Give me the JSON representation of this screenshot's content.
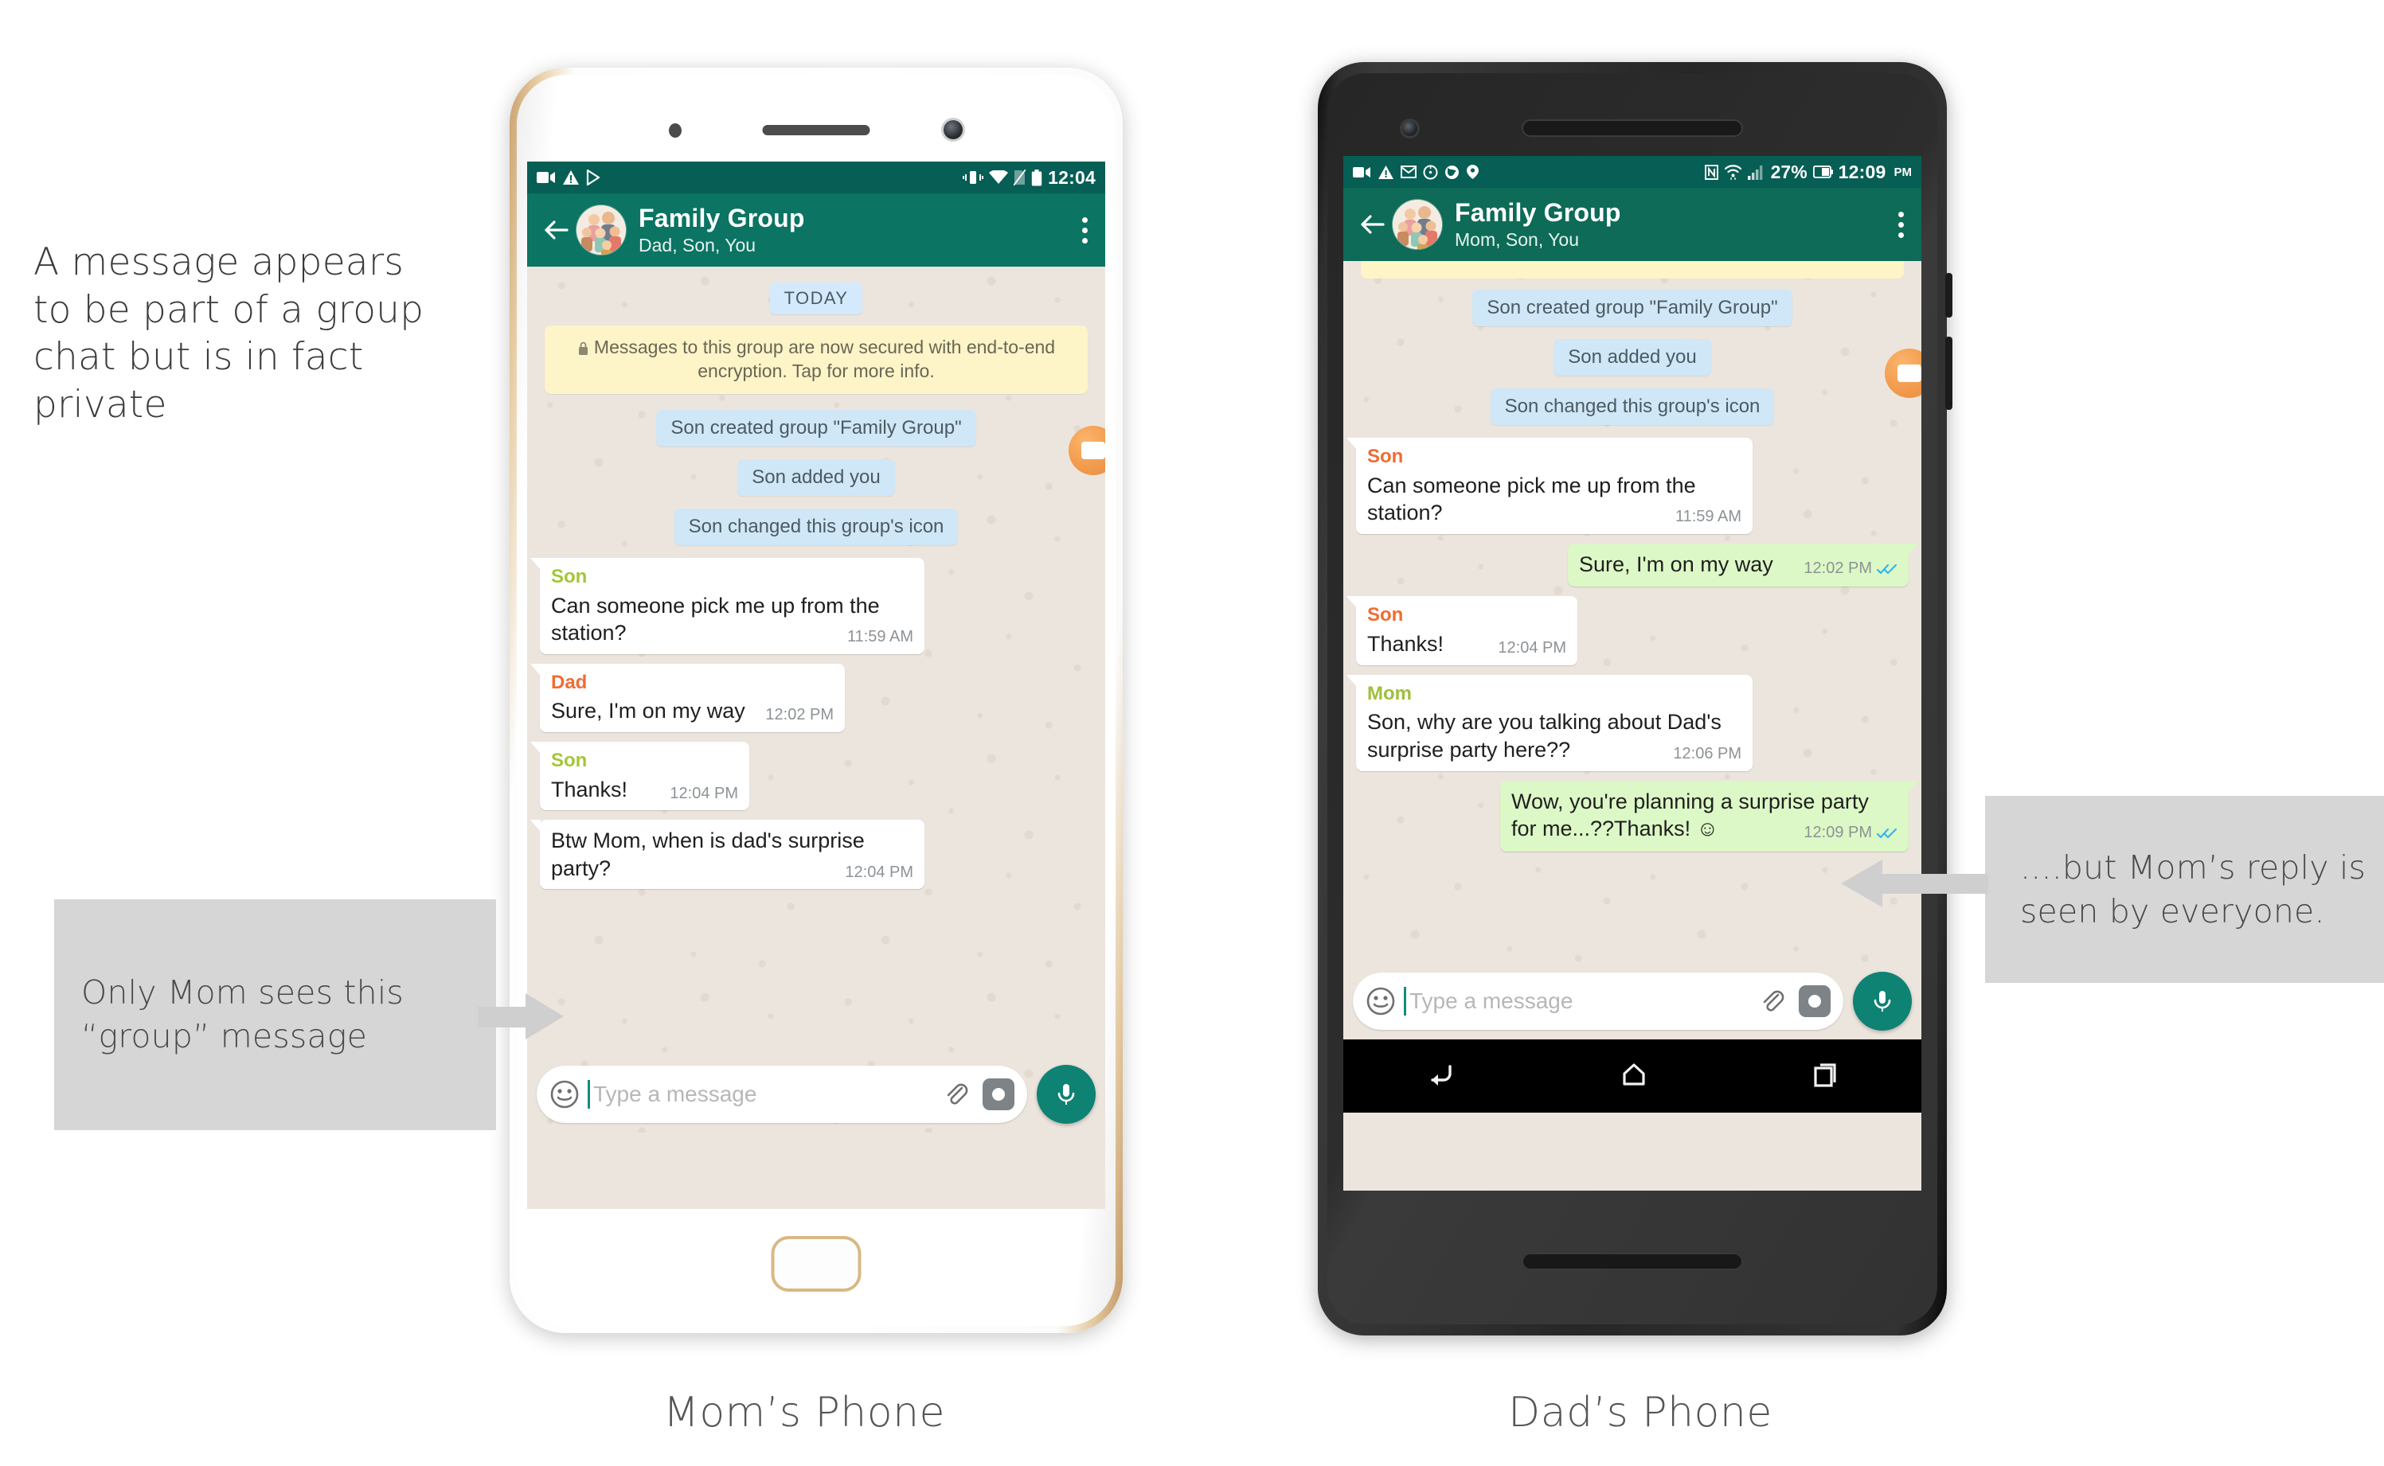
{
  "intro_text": "A message appears to be part of a group chat but is in fact private",
  "callouts": {
    "left": "Only Mom sees this “group” message",
    "right": "....but Mom’s reply is seen by everyone."
  },
  "captions": {
    "mom": "Mom’s Phone",
    "dad": "Dad’s Phone"
  },
  "colors": {
    "statusbar": "#075e54",
    "appbar_mom": "#0b7463",
    "appbar_dad": "#0d6b57",
    "chat_bg": "#ece5dd",
    "bubble_in": "#ffffff",
    "bubble_out": "#dcf8c6",
    "sys_chip": "#cfe7f7",
    "day_chip": "#d4eafc",
    "encryption_notice": "#fdf4c8",
    "sender_son_mom_phone": "#a4c639",
    "sender_dad_mom_phone": "#ef6c33",
    "sender_son_dad_phone": "#ef6c33",
    "sender_mom_dad_phone": "#9fbf3b",
    "tick_blue": "#34b7f1",
    "mic_fab": "#0e8273",
    "callout_bg": "#d6d6d6",
    "arrow": "#cfcfcf"
  },
  "mom_phone": {
    "status_bar": {
      "left_icons": [
        "video-camera-icon",
        "warning-triangle-icon",
        "play-store-icon"
      ],
      "right_icons": [
        "vibrate-icon",
        "wifi-icon",
        "no-sim-icon",
        "battery-icon"
      ],
      "time": "12:04"
    },
    "app_bar": {
      "back_icon": "back-arrow-icon",
      "avatar": "group-avatar",
      "title": "Family Group",
      "subtitle": "Dad, Son, You",
      "menu_icon": "overflow-menu-icon"
    },
    "day_divider": "TODAY",
    "encryption_notice": "Messages to this group are now secured with end-to-end encryption. Tap for more info.",
    "system_messages": [
      "Son created group \"Family Group\"",
      "Son added you",
      "Son changed this group's icon"
    ],
    "messages": [
      {
        "sender": "Son",
        "sender_color_class": "s-green",
        "text": "Can someone pick me up from the station?",
        "time": "11:59 AM",
        "side": "in",
        "ticks": ""
      },
      {
        "sender": "Dad",
        "sender_color_class": "s-orange",
        "text": "Sure, I'm on my way",
        "time": "12:02 PM",
        "side": "in",
        "ticks": ""
      },
      {
        "sender": "Son",
        "sender_color_class": "s-green",
        "text": "Thanks!",
        "time": "12:04 PM",
        "side": "in",
        "ticks": ""
      },
      {
        "sender": "",
        "sender_color_class": "",
        "text": "Btw Mom, when is dad's surprise party?",
        "time": "12:04 PM",
        "side": "in",
        "ticks": ""
      }
    ],
    "composer": {
      "emoji_icon": "smiley-icon",
      "placeholder": "Type a message",
      "attach_icon": "paperclip-icon",
      "camera_icon": "camera-icon",
      "mic_icon": "microphone-icon"
    }
  },
  "dad_phone": {
    "status_bar": {
      "left_icons": [
        "video-camera-icon",
        "warning-triangle-icon",
        "gmail-icon",
        "clock-icon",
        "firefox-icon",
        "location-icon"
      ],
      "right_icons": [
        "nfc-icon",
        "wifi-icon",
        "signal-bars-icon",
        "battery-icon"
      ],
      "battery_percent": "27%",
      "time": "12:09",
      "ampm": "PM"
    },
    "app_bar": {
      "back_icon": "back-arrow-icon",
      "avatar": "group-avatar",
      "title": "Family Group",
      "subtitle": "Mom, Son, You",
      "menu_icon": "overflow-menu-icon"
    },
    "system_messages": [
      "Son created group \"Family Group\"",
      "Son added you",
      "Son changed this group's icon"
    ],
    "messages": [
      {
        "sender": "Son",
        "sender_color_class": "s-orange",
        "text": "Can someone pick me up from the station?",
        "time": "11:59 AM",
        "side": "in",
        "ticks": ""
      },
      {
        "sender": "",
        "sender_color_class": "",
        "text": "Sure, I'm on my way",
        "time": "12:02 PM",
        "side": "out",
        "ticks": "double-check-blue"
      },
      {
        "sender": "Son",
        "sender_color_class": "s-orange",
        "text": "Thanks!",
        "time": "12:04 PM",
        "side": "in",
        "ticks": ""
      },
      {
        "sender": "Mom",
        "sender_color_class": "s-olive",
        "text": "Son, why are you talking about Dad's surprise party here??",
        "time": "12:06 PM",
        "side": "in",
        "ticks": ""
      },
      {
        "sender": "",
        "sender_color_class": "",
        "text": "Wow, you're planning a surprise party for me...??Thanks! ☺",
        "time": "12:09 PM",
        "side": "out",
        "ticks": "double-check-blue"
      }
    ],
    "composer": {
      "emoji_icon": "smiley-icon",
      "placeholder": "Type a message",
      "attach_icon": "paperclip-icon",
      "camera_icon": "camera-icon",
      "mic_icon": "microphone-icon"
    },
    "nav_bar": [
      "back-nav-icon",
      "home-nav-icon",
      "recents-nav-icon"
    ]
  }
}
